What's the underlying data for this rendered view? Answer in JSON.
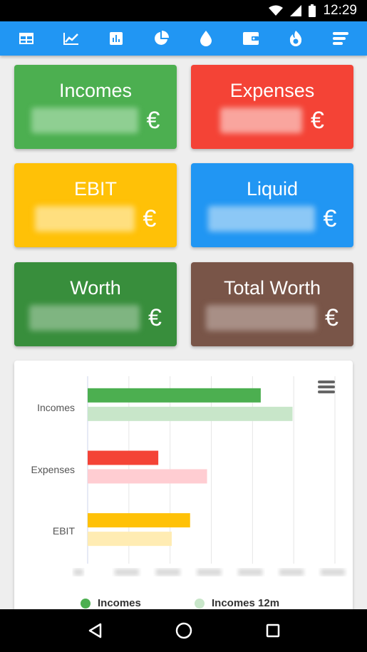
{
  "status_bar": {
    "time": "12:29"
  },
  "toolbar": {
    "icons": [
      "table-icon",
      "trend-icon",
      "bar-chart-icon",
      "pie-chart-icon",
      "drop-icon",
      "wallet-icon",
      "fire-icon",
      "menu-icon"
    ]
  },
  "cards": {
    "incomes": {
      "title": "Incomes",
      "currency": "€",
      "color": "#4caf50"
    },
    "expenses": {
      "title": "Expenses",
      "currency": "€",
      "color": "#f44336"
    },
    "ebit": {
      "title": "EBIT",
      "currency": "€",
      "color": "#ffc107"
    },
    "liquid": {
      "title": "Liquid",
      "currency": "€",
      "color": "#2196f3"
    },
    "worth": {
      "title": "Worth",
      "currency": "€",
      "color": "#388e3c"
    },
    "total_worth": {
      "title": "Total Worth",
      "currency": "€",
      "color": "#795548"
    }
  },
  "chart_data": {
    "type": "bar",
    "orientation": "horizontal",
    "categories": [
      "Incomes",
      "Expenses",
      "EBIT"
    ],
    "series": [
      {
        "name": "Incomes",
        "colors": [
          "#4caf50",
          "#f44336",
          "#ffc107"
        ],
        "values": [
          245,
          100,
          145
        ]
      },
      {
        "name": "Incomes 12m",
        "colors": [
          "#c8e6c9",
          "#ffcdd2",
          "#ffecb3"
        ],
        "values": [
          290,
          169,
          119
        ]
      }
    ],
    "xlim": [
      0,
      350
    ],
    "grid": true,
    "legend_position": "bottom",
    "x_tick_labels_obscured": true
  },
  "legend": {
    "items": [
      {
        "label": "Incomes",
        "color": "#4caf50"
      },
      {
        "label": "Incomes 12m",
        "color": "#c8e6c9"
      }
    ]
  }
}
